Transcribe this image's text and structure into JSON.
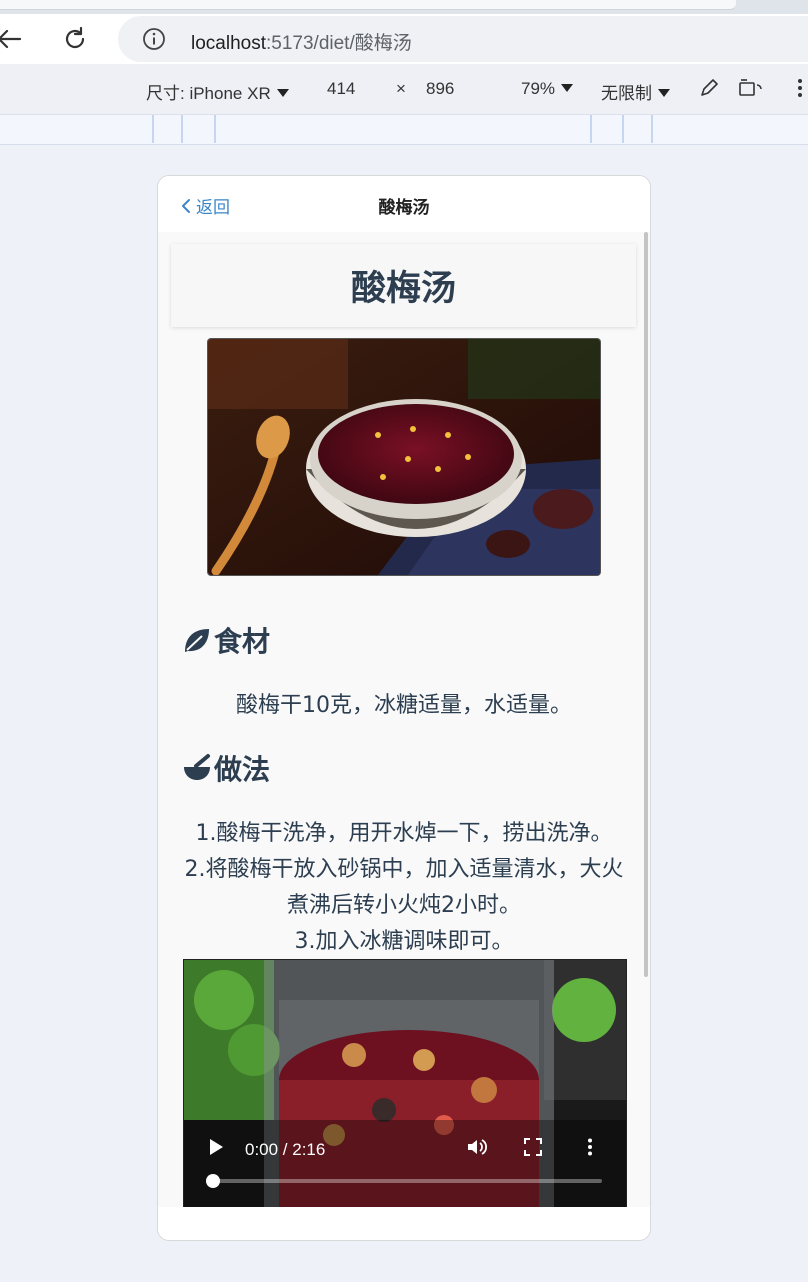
{
  "browser": {
    "url_host": "localhost",
    "url_rest": ":5173/diet/酸梅汤"
  },
  "devtools": {
    "device_label": "尺寸: iPhone XR",
    "width": "414",
    "times": "×",
    "height": "896",
    "zoom": "79%",
    "throttle": "无限制"
  },
  "app": {
    "back_label": "返回",
    "header_title": "酸梅汤",
    "page_title": "酸梅汤",
    "ingredients_heading": "食材",
    "ingredients_text": "酸梅干10克，冰糖适量，水适量。",
    "method_heading": "做法",
    "steps": [
      "1.酸梅干洗净，用开水焯一下，捞出洗净。",
      "2.将酸梅干放入砂锅中，加入适量清水，大火",
      "煮沸后转小火炖2小时。",
      "3.加入冰糖调味即可。"
    ],
    "video_time": "0:00 / 2:16",
    "video_progress": 0
  },
  "colors": {
    "accent": "#3a86c8",
    "heading": "#2c3e50"
  }
}
